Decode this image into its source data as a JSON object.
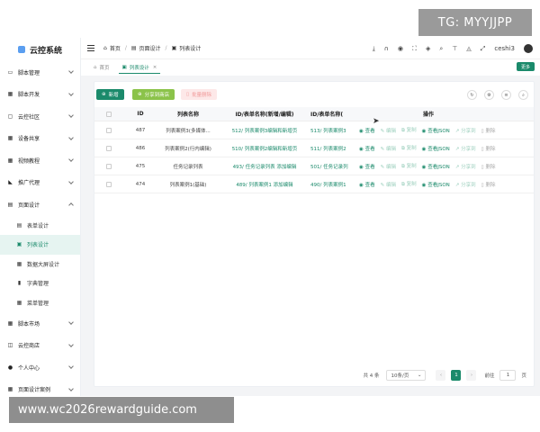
{
  "watermarks": {
    "top": "TG: MYYJJPP",
    "bottom": "www.wc2026rewardguide.com"
  },
  "app": {
    "title": "云控系统"
  },
  "sidebar": {
    "items": [
      {
        "label": "脚本管理",
        "icon": "folder-icon",
        "expanded": false
      },
      {
        "label": "脚本开发",
        "icon": "grid-icon",
        "expanded": false
      },
      {
        "label": "云控社区",
        "icon": "community-icon",
        "expanded": false
      },
      {
        "label": "设备共享",
        "icon": "grid-icon",
        "expanded": false
      },
      {
        "label": "视频教程",
        "icon": "grid-icon",
        "expanded": false
      },
      {
        "label": "推广代理",
        "icon": "promo-icon",
        "expanded": false
      },
      {
        "label": "页面设计",
        "icon": "design-icon",
        "expanded": true,
        "children": [
          {
            "label": "表单设计",
            "icon": "form-icon",
            "active": false
          },
          {
            "label": "列表设计",
            "icon": "list-icon",
            "active": true
          },
          {
            "label": "数据大屏设计",
            "icon": "screen-icon",
            "active": false
          },
          {
            "label": "字典管理",
            "icon": "dict-icon",
            "active": false
          },
          {
            "label": "菜单管理",
            "icon": "menu-icon",
            "active": false
          }
        ]
      },
      {
        "label": "脚本市场",
        "icon": "grid-icon",
        "expanded": false
      },
      {
        "label": "云控商店",
        "icon": "store-icon",
        "expanded": false
      },
      {
        "label": "个人中心",
        "icon": "user-icon",
        "expanded": false
      },
      {
        "label": "页面设计案例",
        "icon": "grid-icon",
        "expanded": false
      }
    ]
  },
  "topbar": {
    "breadcrumb": [
      "首页",
      "页面设计",
      "列表设计"
    ],
    "username": "ceshi3"
  },
  "tabs": [
    {
      "label": "首页",
      "active": false
    },
    {
      "label": "列表设计",
      "active": true
    }
  ],
  "more_button": "更多",
  "toolbar": {
    "new": "新增",
    "share": "分享到商店",
    "delete": "批量删除"
  },
  "table": {
    "headers": [
      "ID",
      "列表名称",
      "ID/表单名称(新增/编辑)",
      "ID/表单名称(",
      "操作"
    ],
    "rows": [
      {
        "id": "487",
        "name": "列表案例3(多媒体...",
        "form1": "512/ 列表案例3编辑和新增页",
        "form2": "513/ 列表案例3"
      },
      {
        "id": "486",
        "name": "列表案例2(行内编辑)",
        "form1": "510/ 列表案例2编辑和新增页",
        "form2": "511/ 列表案例2"
      },
      {
        "id": "475",
        "name": "任务记录列表",
        "form1": "493/ 任务记录列表 添加编辑",
        "form2": "501/ 任务记录列"
      },
      {
        "id": "474",
        "name": "列表案例1(基础)",
        "form1": "489/ 列表案例1 添加编辑",
        "form2": "490/ 列表案例1"
      }
    ],
    "ops": {
      "view": "查看",
      "edit": "编辑",
      "copy": "复制",
      "json": "查看JSON",
      "share": "分享到",
      "delete": "删除"
    }
  },
  "pagination": {
    "total": "共 4 条",
    "page_size": "10条/页",
    "current": "1",
    "goto_label": "前往",
    "goto_value": "1",
    "page_unit": "页"
  }
}
